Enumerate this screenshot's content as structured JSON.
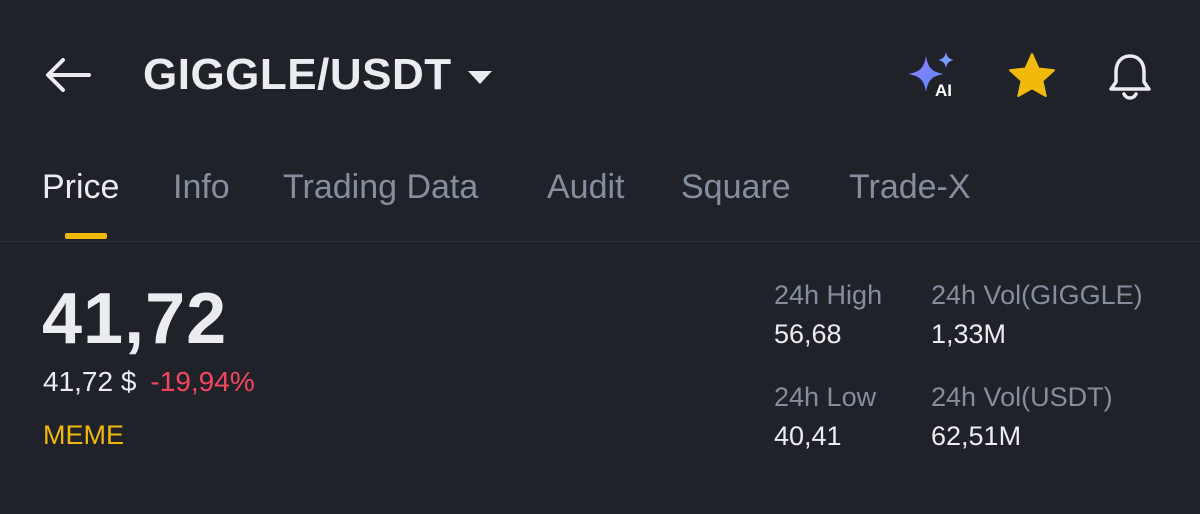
{
  "header": {
    "pair": "GIGGLE/USDT",
    "icons": {
      "back": "arrow-left-icon",
      "ai": "ai-sparkle-icon",
      "ai_label": "AI",
      "favorite": "star-icon",
      "alert": "bell-icon"
    },
    "favorite_color": "#F0B90B"
  },
  "tabs": [
    {
      "label": "Price",
      "active": true
    },
    {
      "label": "Info",
      "active": false
    },
    {
      "label": "Trading Data",
      "active": false
    },
    {
      "label": "Audit",
      "active": false
    },
    {
      "label": "Square",
      "active": false
    },
    {
      "label": "Trade-X",
      "active": false
    }
  ],
  "price": {
    "last": "41,72",
    "usd": "41,72 $",
    "change": "-19,94%",
    "tag": "MEME"
  },
  "stats": {
    "high_label": "24h High",
    "high_value": "56,68",
    "vol_coin_label": "24h Vol(GIGGLE)",
    "vol_coin_value": "1,33M",
    "low_label": "24h Low",
    "low_value": "40,41",
    "vol_usdt_label": "24h Vol(USDT)",
    "vol_usdt_value": "62,51M"
  },
  "colors": {
    "background": "#1F2229",
    "accent": "#F0B90B",
    "negative": "#F6465D",
    "muted": "#848E9C",
    "text": "#EAECEF"
  }
}
